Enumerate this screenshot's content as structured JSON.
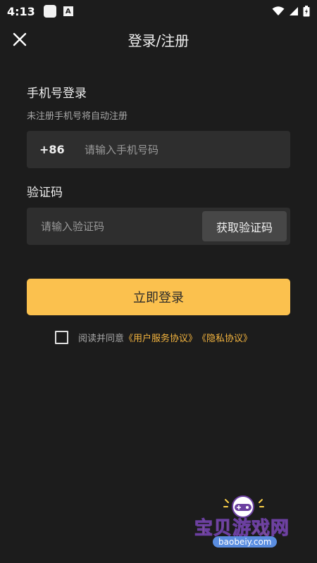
{
  "status_bar": {
    "time": "4:13",
    "app_badge": "A",
    "icons": [
      "wifi-icon",
      "signal-icon",
      "battery-icon"
    ]
  },
  "header": {
    "title": "登录/注册",
    "close_icon": "close-icon"
  },
  "phone_login": {
    "heading": "手机号登录",
    "subtitle": "未注册手机号将自动注册",
    "country_code": "+86",
    "phone_placeholder": "请输入手机号码",
    "phone_value": ""
  },
  "verification": {
    "heading": "验证码",
    "code_placeholder": "请输入验证码",
    "code_value": "",
    "get_code_label": "获取验证码"
  },
  "login_button": "立即登录",
  "agreement": {
    "checked": false,
    "prefix": "阅读并同意",
    "user_agreement": "《用户服务协议》",
    "privacy_policy": "《隐私协议》"
  },
  "watermark": {
    "name": "宝贝游戏网",
    "url": "baobeiy.com"
  },
  "colors": {
    "background": "#1c1c1c",
    "field": "#2e2e2e",
    "accent": "#fbc14e",
    "link": "#f5b53f"
  }
}
